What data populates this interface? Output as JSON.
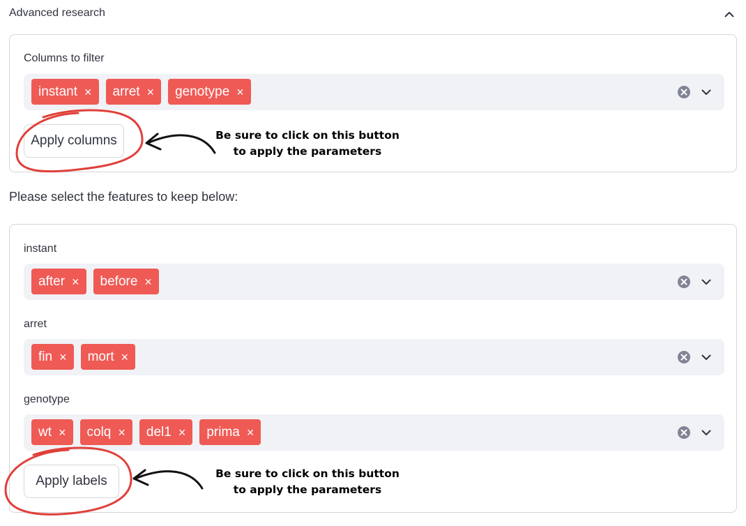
{
  "expander": {
    "title": "Advanced research",
    "toggle_icon": "chevron-up-icon"
  },
  "columns_filter": {
    "label": "Columns to filter",
    "tags": [
      "instant",
      "arret",
      "genotype"
    ],
    "apply_label": "Apply columns"
  },
  "note": {
    "line1": "Be sure to click on this button",
    "line2": "to apply the parameters"
  },
  "features_prompt": "Please select the features to keep below:",
  "features": {
    "instant": {
      "label": "instant",
      "tags": [
        "after",
        "before"
      ]
    },
    "arret": {
      "label": "arret",
      "tags": [
        "fin",
        "mort"
      ]
    },
    "genotype": {
      "label": "genotype",
      "tags": [
        "wt",
        "colq",
        "del1",
        "prima"
      ]
    },
    "apply_label": "Apply labels"
  },
  "tag_remove_glyph": "×",
  "colors": {
    "tag": "#ef5a55",
    "field_bg": "#f0f2f6",
    "annotation_circle": "#e0403a",
    "text": "#31333f"
  }
}
